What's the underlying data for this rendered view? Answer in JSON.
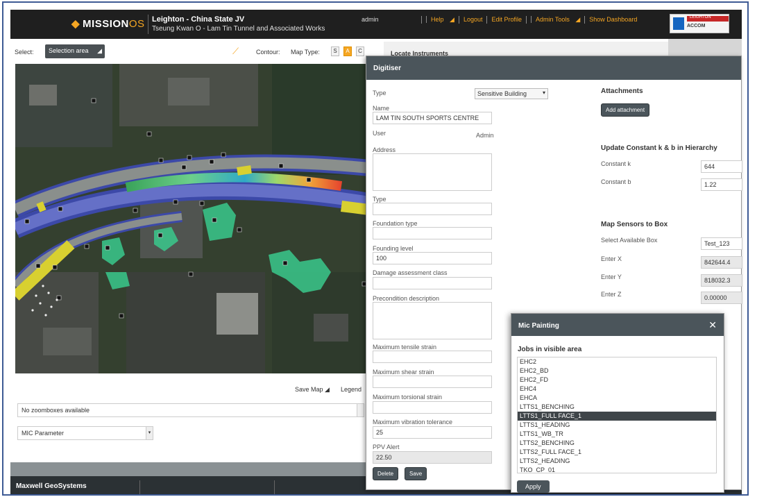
{
  "header": {
    "logo_main": "MISSION",
    "logo_os": "OS",
    "project_title": "Leighton - China State JV",
    "project_subtitle": "Tseung Kwan O - Lam Tin Tunnel and Associated Works",
    "user": "admin",
    "nav": [
      "Help",
      "Logout",
      "Edit Profile",
      "Admin Tools",
      "Show Dashboard"
    ],
    "brand_top": "LEIGHTON",
    "brand_bottom": "ACCOM"
  },
  "toolbar": {
    "select_label": "Select:",
    "select_value": "Selection area",
    "contour_label": "Contour:",
    "maptype_label": "Map Type:",
    "maptype_options": [
      "S",
      "A",
      "C"
    ]
  },
  "map_footer": {
    "save_map": "Save Map",
    "legend": "Legend",
    "zoombox_value": "No zoomboxes available",
    "parameter_value": "MIC Parameter"
  },
  "behind": {
    "locate_title": "Locate Instruments"
  },
  "footer": {
    "company": "Maxwell GeoSystems"
  },
  "digitiser": {
    "title": "Digitiser",
    "type_label": "Type",
    "type_value": "Sensitive Building",
    "name_label": "Name",
    "name_value": "LAM TIN SOUTH SPORTS CENTRE",
    "user_label": "User",
    "user_value": "Admin",
    "address_label": "Address",
    "type2_label": "Type",
    "foundation_type_label": "Foundation type",
    "founding_level_label": "Founding level",
    "founding_level_value": "100",
    "damage_label": "Damage assessment class",
    "precondition_label": "Precondition description",
    "max_tensile_label": "Maximum tensile strain",
    "max_shear_label": "Maximum shear strain",
    "max_torsional_label": "Maximum torsional strain",
    "max_vibration_label": "Maximum vibration tolerance",
    "max_vibration_value": "25",
    "ppv_label": "PPV Alert",
    "ppv_value": "22.50",
    "delete_btn": "Delete",
    "save_btn": "Save",
    "attachments_title": "Attachments",
    "add_attachment_btn": "Add attachment",
    "update_title": "Update Constant k & b in Hierarchy",
    "constant_k_label": "Constant k",
    "constant_k_value": "644",
    "constant_b_label": "Constant b",
    "constant_b_value": "1.22",
    "map_sensors_title": "Map Sensors to Box",
    "select_box_label": "Select Available Box",
    "select_box_value": "Test_123",
    "enter_x_label": "Enter X",
    "enter_x_value": "842644.4",
    "enter_y_label": "Enter Y",
    "enter_y_value": "818032.3",
    "enter_z_label": "Enter Z",
    "enter_z_value": "0.00000"
  },
  "mic": {
    "title": "Mic Painting",
    "subtitle": "Jobs in visible area",
    "jobs": [
      "EHC2",
      "EHC2_BD",
      "EHC2_FD",
      "EHC4",
      "EHCA",
      "LTTS1_BENCHING",
      "LTTS1_FULL FACE_1",
      "LTTS1_HEADING",
      "LTTS1_WB_TR",
      "LTTS2_BENCHING",
      "LTTS2_FULL FACE_1",
      "LTTS2_HEADING",
      "TKO_CP_01"
    ],
    "selected_job": "LTTS1_FULL FACE_1",
    "apply_btn": "Apply"
  },
  "colors": {
    "accent": "#f5a623",
    "header_bg": "#1f1f1f",
    "panel_head": "#4b555b",
    "frame_border": "#3d5a94"
  }
}
